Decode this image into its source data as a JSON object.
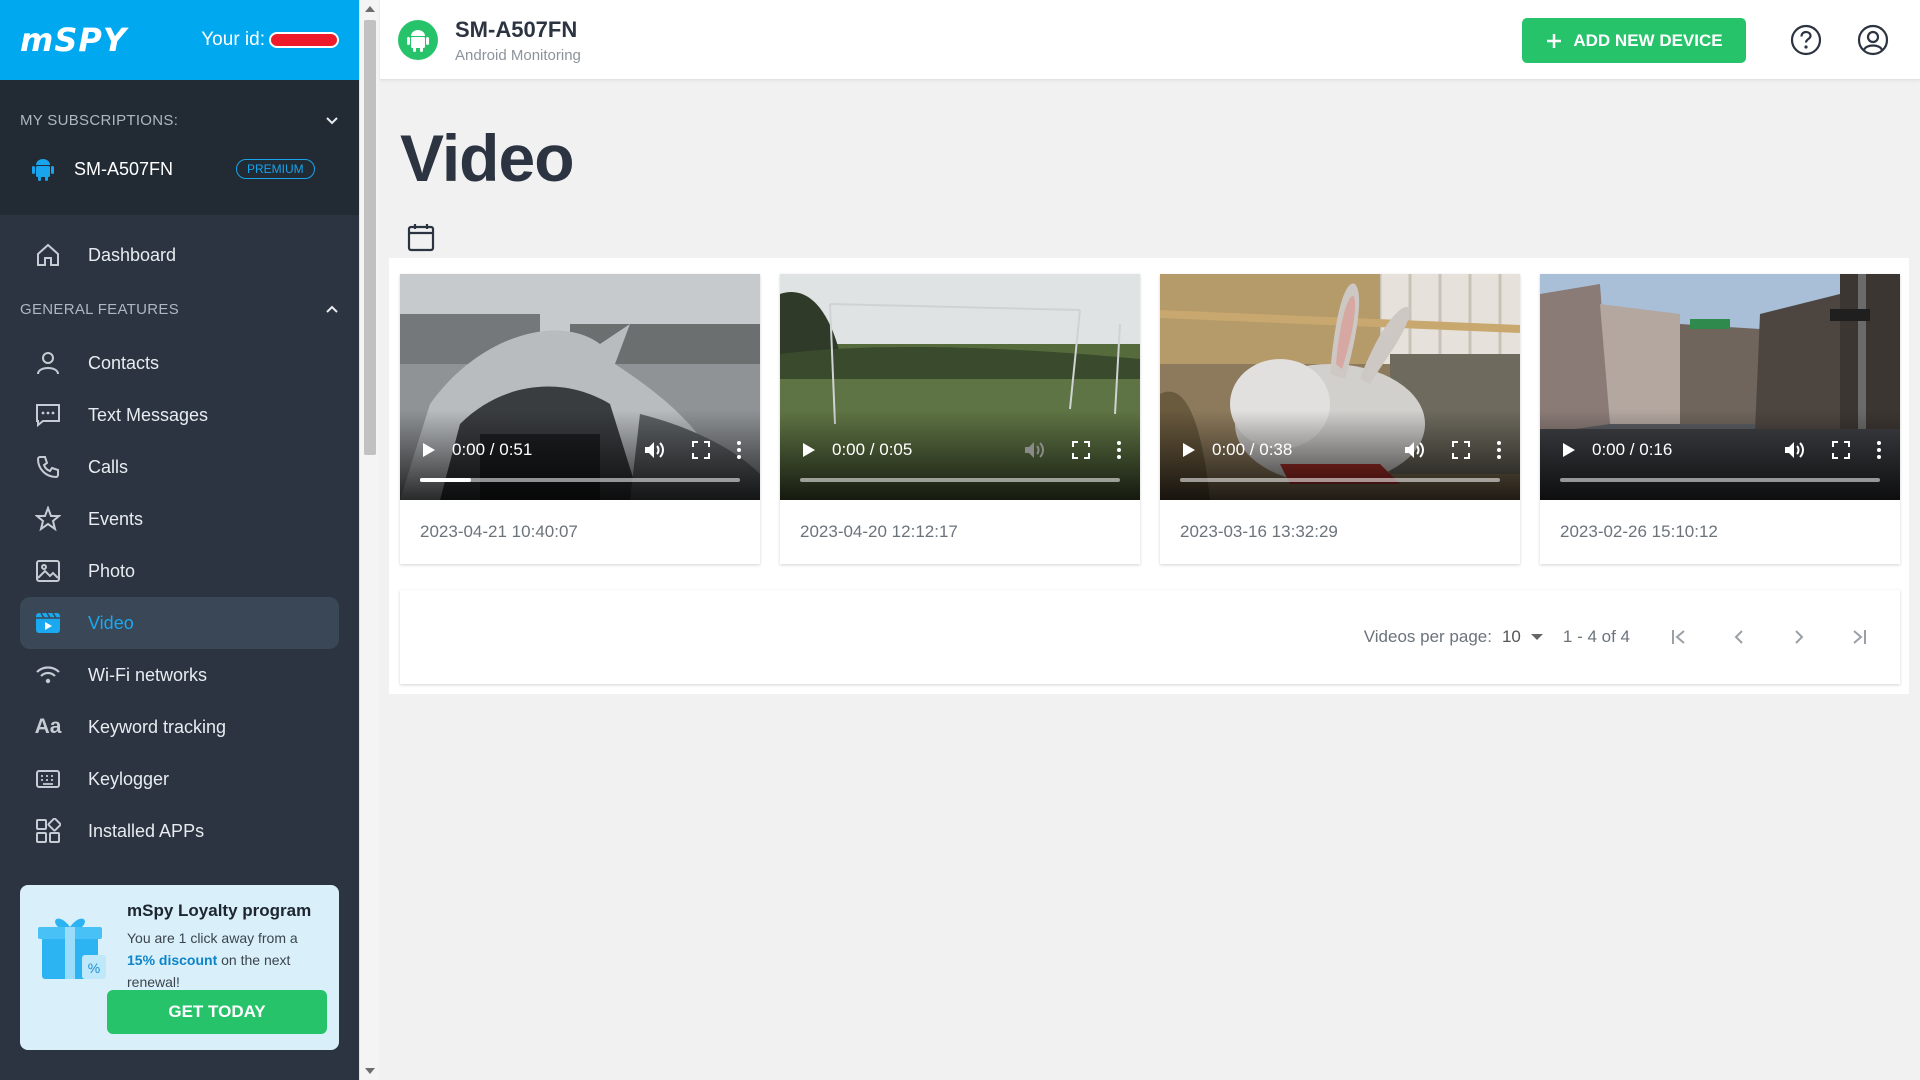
{
  "brand": {
    "logo": "mSPY",
    "id_label": "Your id:"
  },
  "subscriptions": {
    "title": "MY SUBSCRIPTIONS:",
    "device": "SM-A507FN",
    "badge": "PREMIUM"
  },
  "nav": {
    "dashboard": "Dashboard",
    "section": "GENERAL FEATURES",
    "items": [
      {
        "label": "Contacts",
        "icon": "person-icon"
      },
      {
        "label": "Text Messages",
        "icon": "message-icon"
      },
      {
        "label": "Calls",
        "icon": "phone-icon"
      },
      {
        "label": "Events",
        "icon": "star-icon"
      },
      {
        "label": "Photo",
        "icon": "image-icon"
      },
      {
        "label": "Video",
        "icon": "video-icon",
        "active": true
      },
      {
        "label": "Wi-Fi networks",
        "icon": "wifi-icon"
      },
      {
        "label": "Keyword tracking",
        "icon": "text-icon"
      },
      {
        "label": "Keylogger",
        "icon": "keyboard-icon"
      },
      {
        "label": "Installed APPs",
        "icon": "apps-icon"
      }
    ]
  },
  "loyalty": {
    "title": "mSpy Loyalty program",
    "text_before": "You are 1 click away from a ",
    "highlight": "15% discount",
    "text_after": " on the next renewal!",
    "button": "GET TODAY"
  },
  "header": {
    "device": "SM-A507FN",
    "subtitle": "Android Monitoring",
    "add_button": "ADD NEW DEVICE"
  },
  "page": {
    "title": "Video"
  },
  "videos": [
    {
      "time": "0:00 / 0:51",
      "date": "2023-04-21 10:40:07",
      "progress": 0.16,
      "muted": false
    },
    {
      "time": "0:00 / 0:05",
      "date": "2023-04-20 12:12:17",
      "progress": 0.0,
      "muted": true
    },
    {
      "time": "0:00 / 0:38",
      "date": "2023-03-16 13:32:29",
      "progress": 0.0,
      "muted": false
    },
    {
      "time": "0:00 / 0:16",
      "date": "2023-02-26 15:10:12",
      "progress": 0.0,
      "muted": false
    }
  ],
  "pagination": {
    "per_page_label": "Videos per page:",
    "per_page": "10",
    "range": "1 - 4 of 4"
  },
  "colors": {
    "brand_blue": "#00a8f0",
    "sidebar": "#2b3440",
    "green": "#27c36a",
    "active_blue": "#1aa8f0"
  }
}
